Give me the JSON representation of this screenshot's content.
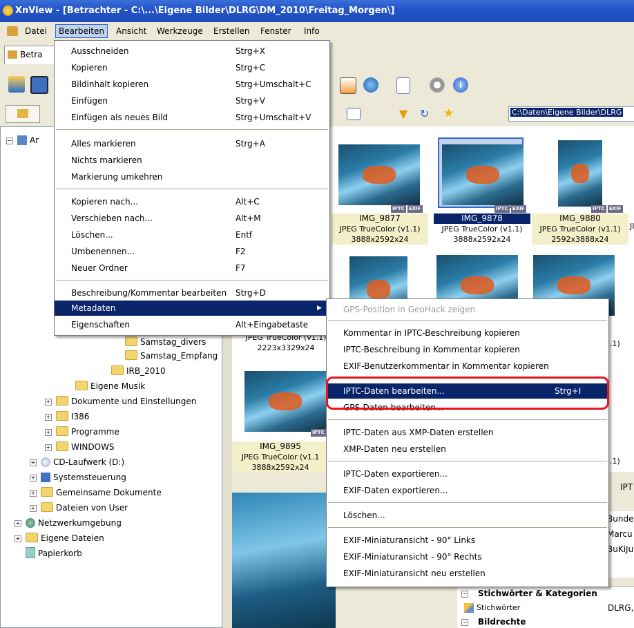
{
  "window": {
    "title": "XnView - [Betrachter - C:\\...\\Eigene Bilder\\DLRG\\DM_2010\\Freitag_Morgen\\]"
  },
  "menubar": [
    "Datei",
    "Bearbeiten",
    "Ansicht",
    "Werkzeuge",
    "Erstellen",
    "Fenster",
    "Info"
  ],
  "tab": {
    "label": "Betra"
  },
  "path_field": {
    "value": "C:\\Daten\\Eigene Bilder\\DLRG"
  },
  "edit_menu": {
    "items": [
      {
        "label": "Ausschneiden",
        "key": "Strg+X"
      },
      {
        "label": "Kopieren",
        "key": "Strg+C"
      },
      {
        "label": "Bildinhalt kopieren",
        "key": "Strg+Umschalt+C"
      },
      {
        "label": "Einfügen",
        "key": "Strg+V"
      },
      {
        "label": "Einfügen als neues Bild",
        "key": "Strg+Umschalt+V"
      },
      {
        "label": "Alles markieren",
        "key": "Strg+A"
      },
      {
        "label": "Nichts markieren",
        "key": ""
      },
      {
        "label": "Markierung umkehren",
        "key": ""
      },
      {
        "label": "Kopieren nach...",
        "key": "Alt+C"
      },
      {
        "label": "Verschieben nach...",
        "key": "Alt+M"
      },
      {
        "label": "Löschen...",
        "key": "Entf"
      },
      {
        "label": "Umbenennen...",
        "key": "F2"
      },
      {
        "label": "Neuer Ordner",
        "key": "F7"
      },
      {
        "label": "Beschreibung/Kommentar bearbeiten",
        "key": "Strg+D"
      },
      {
        "label": "Metadaten",
        "key": ""
      },
      {
        "label": "Eigenschaften",
        "key": "Alt+Eingabetaste"
      }
    ]
  },
  "meta_menu": {
    "items": [
      {
        "label": "GPS-Position in GeoHack zeigen",
        "key": ""
      },
      {
        "label": "Kommentar in IPTC-Beschreibung kopieren",
        "key": ""
      },
      {
        "label": "IPTC-Beschreibung in Kommentar kopieren",
        "key": ""
      },
      {
        "label": "EXIF-Benutzerkommentar in Kommentar kopieren",
        "key": ""
      },
      {
        "label": "IPTC-Daten bearbeiten...",
        "key": "Strg+I"
      },
      {
        "label": "GPS-Daten bearbeiten...",
        "key": ""
      },
      {
        "label": "IPTC-Daten aus XMP-Daten erstellen",
        "key": ""
      },
      {
        "label": "XMP-Daten neu erstellen",
        "key": ""
      },
      {
        "label": "IPTC-Daten exportieren...",
        "key": ""
      },
      {
        "label": "EXIF-Daten exportieren...",
        "key": ""
      },
      {
        "label": "Löschen...",
        "key": ""
      },
      {
        "label": "EXIF-Miniaturansicht - 90° Links",
        "key": ""
      },
      {
        "label": "EXIF-Miniaturansicht - 90° Rechts",
        "key": ""
      },
      {
        "label": "EXIF-Miniaturansicht neu erstellen",
        "key": ""
      }
    ]
  },
  "tree": {
    "items": [
      {
        "label": "Ar"
      },
      {
        "label": "Samstag_divers"
      },
      {
        "label": "Samstag_Empfang"
      },
      {
        "label": "IRB_2010"
      },
      {
        "label": "Eigene Musik"
      },
      {
        "label": "Dokumente und Einstellungen"
      },
      {
        "label": "I386"
      },
      {
        "label": "Programme"
      },
      {
        "label": "WINDOWS"
      },
      {
        "label": "CD-Laufwerk (D:)"
      },
      {
        "label": "Systemsteuerung"
      },
      {
        "label": "Gemeinsame Dokumente"
      },
      {
        "label": "Dateien von User"
      },
      {
        "label": "Netzwerkumgebung"
      },
      {
        "label": "Eigene Dateien"
      },
      {
        "label": "Papierkorb"
      }
    ]
  },
  "thumbnails": [
    {
      "name": "IMG_9877",
      "format": "JPEG TrueColor (v1.1)",
      "dims": "3888x2592x24"
    },
    {
      "name": "IMG_9878",
      "format": "JPEG TrueColor (v1.1)",
      "dims": "3888x2592x24"
    },
    {
      "name": "IMG_9880",
      "format": "JPEG TrueColor (v1.1)",
      "dims": "2592x3888x24"
    },
    {
      "name": "",
      "format": "JPEG TrueColor (v1.1)",
      "dims": "2223x3329x24"
    },
    {
      "name": "IMG_9895",
      "format": "JPEG TrueColor (v1.1",
      "dims": "3888x2592x24"
    }
  ],
  "partial_right": {
    "mid1": "1.1)",
    "mid2": "1.1)",
    "jl": "JI",
    "iptc_tab": "IPT",
    "exif_badge": "EXIF",
    "iptc_badge": "IPTC"
  },
  "info_panel": {
    "section_keywords": "Stichwörter & Kategorien",
    "row_keywords_label": "Stichwörter",
    "row_keywords_value": "DLRG,",
    "section_rights": "Bildrechte",
    "right_values": [
      "Bunde",
      "Marcu",
      "BuKiJu"
    ]
  }
}
